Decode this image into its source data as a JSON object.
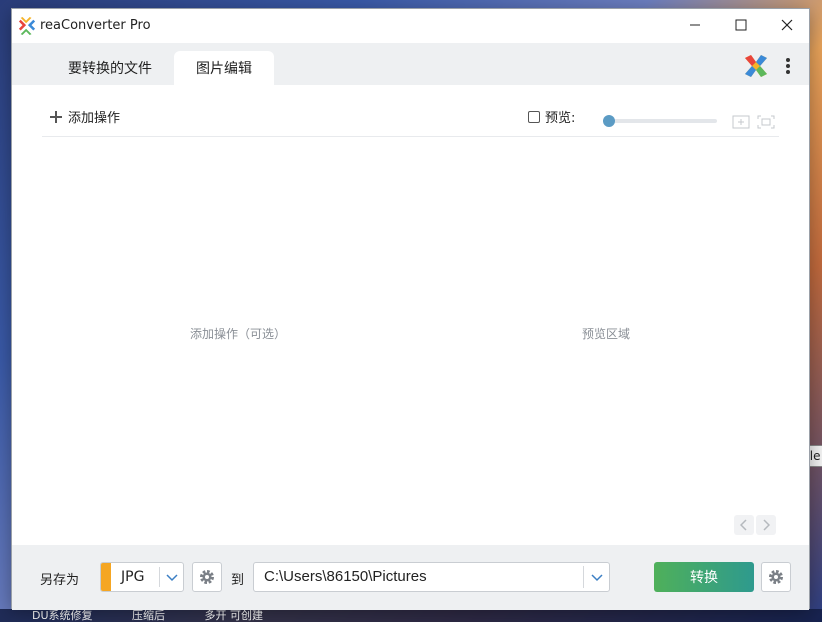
{
  "window": {
    "title": "reaConverter Pro"
  },
  "tabs": {
    "files": "要转换的文件",
    "edit": "图片编辑"
  },
  "toolbar": {
    "add_operation": "添加操作",
    "preview_label": "预览:",
    "preview_checked": false,
    "zoom_level": 0
  },
  "content": {
    "operations_placeholder": "添加操作（可选）",
    "preview_placeholder": "预览区域"
  },
  "bottom": {
    "save_as_label": "另存为",
    "format": "JPG",
    "to_label": "到",
    "output_path": "C:\\Users\\86150\\Pictures",
    "convert_label": "转换"
  },
  "desktop": {
    "tooltip": "Double",
    "taskbar_items": [
      "DU系统修复",
      "压缩后",
      "多开 可创建"
    ]
  },
  "colors": {
    "format_accent": "#f5a623",
    "convert_start": "#4fb05a",
    "convert_end": "#2e9a8e",
    "slider_thumb": "#5b9bc4"
  }
}
